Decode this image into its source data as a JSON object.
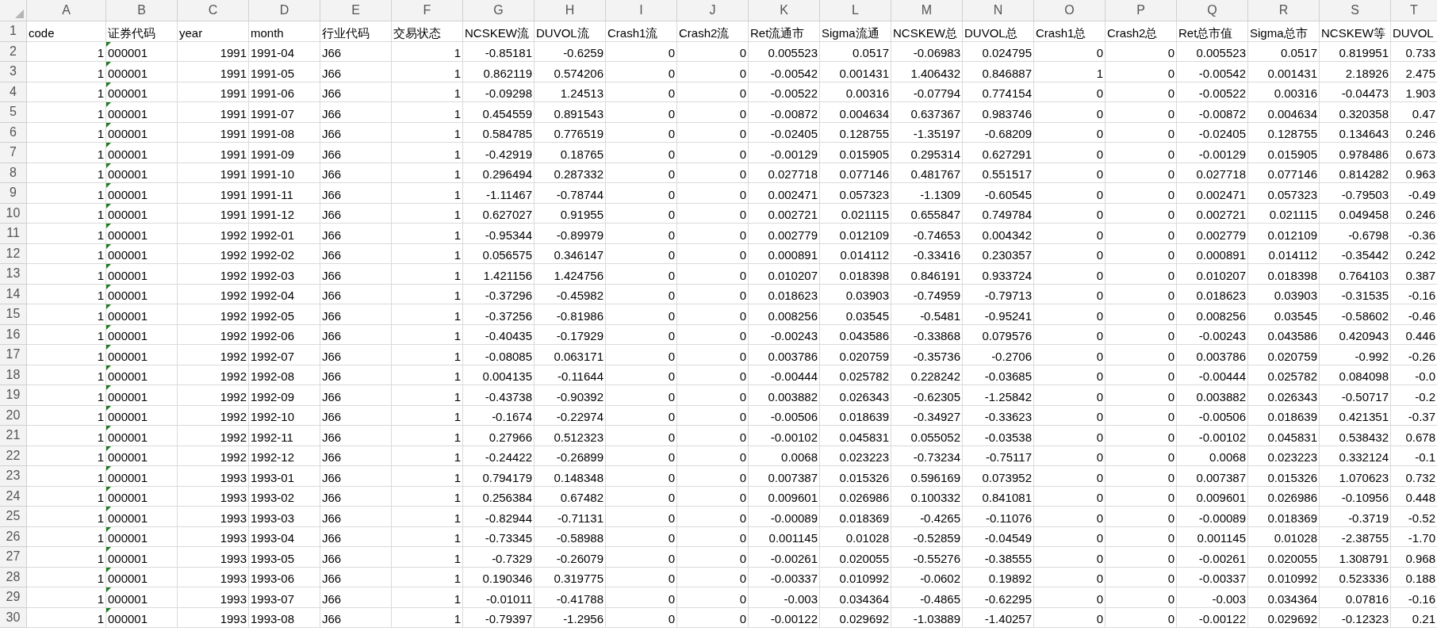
{
  "columns": [
    {
      "letter": "A",
      "header": "code",
      "kind": "number"
    },
    {
      "letter": "B",
      "header": "证券代码",
      "kind": "text_number"
    },
    {
      "letter": "C",
      "header": "year",
      "kind": "number"
    },
    {
      "letter": "D",
      "header": "month",
      "kind": "text"
    },
    {
      "letter": "E",
      "header": "行业代码",
      "kind": "text"
    },
    {
      "letter": "F",
      "header": "交易状态",
      "kind": "number"
    },
    {
      "letter": "G",
      "header": "NCSKEW流",
      "kind": "number"
    },
    {
      "letter": "H",
      "header": "DUVOL流",
      "kind": "number"
    },
    {
      "letter": "I",
      "header": "Crash1流",
      "kind": "number"
    },
    {
      "letter": "J",
      "header": "Crash2流",
      "kind": "number"
    },
    {
      "letter": "K",
      "header": "Ret流通市",
      "kind": "number"
    },
    {
      "letter": "L",
      "header": "Sigma流通",
      "kind": "number"
    },
    {
      "letter": "M",
      "header": "NCSKEW总",
      "kind": "number"
    },
    {
      "letter": "N",
      "header": "DUVOL总",
      "kind": "number"
    },
    {
      "letter": "O",
      "header": "Crash1总",
      "kind": "number"
    },
    {
      "letter": "P",
      "header": "Crash2总",
      "kind": "number"
    },
    {
      "letter": "Q",
      "header": "Ret总市值",
      "kind": "number"
    },
    {
      "letter": "R",
      "header": "Sigma总市",
      "kind": "number"
    },
    {
      "letter": "S",
      "header": "NCSKEW等",
      "kind": "number"
    },
    {
      "letter": "T",
      "header": "DUVOL",
      "kind": "number"
    }
  ],
  "header_row_number": "1",
  "rows": [
    {
      "number": "2",
      "cells": [
        "1",
        "000001",
        "1991",
        "1991-04",
        "J66",
        "1",
        "-0.85181",
        "-0.6259",
        "0",
        "0",
        "0.005523",
        "0.0517",
        "-0.06983",
        "0.024795",
        "0",
        "0",
        "0.005523",
        "0.0517",
        "0.819951",
        "0.733"
      ]
    },
    {
      "number": "3",
      "cells": [
        "1",
        "000001",
        "1991",
        "1991-05",
        "J66",
        "1",
        "0.862119",
        "0.574206",
        "0",
        "0",
        "-0.00542",
        "0.001431",
        "1.406432",
        "0.846887",
        "1",
        "0",
        "-0.00542",
        "0.001431",
        "2.18926",
        "2.475"
      ]
    },
    {
      "number": "4",
      "cells": [
        "1",
        "000001",
        "1991",
        "1991-06",
        "J66",
        "1",
        "-0.09298",
        "1.24513",
        "0",
        "0",
        "-0.00522",
        "0.00316",
        "-0.07794",
        "0.774154",
        "0",
        "0",
        "-0.00522",
        "0.00316",
        "-0.04473",
        "1.903"
      ]
    },
    {
      "number": "5",
      "cells": [
        "1",
        "000001",
        "1991",
        "1991-07",
        "J66",
        "1",
        "0.454559",
        "0.891543",
        "0",
        "0",
        "-0.00872",
        "0.004634",
        "0.637367",
        "0.983746",
        "0",
        "0",
        "-0.00872",
        "0.004634",
        "0.320358",
        "0.47"
      ]
    },
    {
      "number": "6",
      "cells": [
        "1",
        "000001",
        "1991",
        "1991-08",
        "J66",
        "1",
        "0.584785",
        "0.776519",
        "0",
        "0",
        "-0.02405",
        "0.128755",
        "-1.35197",
        "-0.68209",
        "0",
        "0",
        "-0.02405",
        "0.128755",
        "0.134643",
        "0.246"
      ]
    },
    {
      "number": "7",
      "cells": [
        "1",
        "000001",
        "1991",
        "1991-09",
        "J66",
        "1",
        "-0.42919",
        "0.18765",
        "0",
        "0",
        "-0.00129",
        "0.015905",
        "0.295314",
        "0.627291",
        "0",
        "0",
        "-0.00129",
        "0.015905",
        "0.978486",
        "0.673"
      ]
    },
    {
      "number": "8",
      "cells": [
        "1",
        "000001",
        "1991",
        "1991-10",
        "J66",
        "1",
        "0.296494",
        "0.287332",
        "0",
        "0",
        "0.027718",
        "0.077146",
        "0.481767",
        "0.551517",
        "0",
        "0",
        "0.027718",
        "0.077146",
        "0.814282",
        "0.963"
      ]
    },
    {
      "number": "9",
      "cells": [
        "1",
        "000001",
        "1991",
        "1991-11",
        "J66",
        "1",
        "-1.11467",
        "-0.78744",
        "0",
        "0",
        "0.002471",
        "0.057323",
        "-1.1309",
        "-0.60545",
        "0",
        "0",
        "0.002471",
        "0.057323",
        "-0.79503",
        "-0.49"
      ]
    },
    {
      "number": "10",
      "cells": [
        "1",
        "000001",
        "1991",
        "1991-12",
        "J66",
        "1",
        "0.627027",
        "0.91955",
        "0",
        "0",
        "0.002721",
        "0.021115",
        "0.655847",
        "0.749784",
        "0",
        "0",
        "0.002721",
        "0.021115",
        "0.049458",
        "0.246"
      ]
    },
    {
      "number": "11",
      "cells": [
        "1",
        "000001",
        "1992",
        "1992-01",
        "J66",
        "1",
        "-0.95344",
        "-0.89979",
        "0",
        "0",
        "0.002779",
        "0.012109",
        "-0.74653",
        "0.004342",
        "0",
        "0",
        "0.002779",
        "0.012109",
        "-0.6798",
        "-0.36"
      ]
    },
    {
      "number": "12",
      "cells": [
        "1",
        "000001",
        "1992",
        "1992-02",
        "J66",
        "1",
        "0.056575",
        "0.346147",
        "0",
        "0",
        "0.000891",
        "0.014112",
        "-0.33416",
        "0.230357",
        "0",
        "0",
        "0.000891",
        "0.014112",
        "-0.35442",
        "0.242"
      ]
    },
    {
      "number": "13",
      "cells": [
        "1",
        "000001",
        "1992",
        "1992-03",
        "J66",
        "1",
        "1.421156",
        "1.424756",
        "0",
        "0",
        "0.010207",
        "0.018398",
        "0.846191",
        "0.933724",
        "0",
        "0",
        "0.010207",
        "0.018398",
        "0.764103",
        "0.387"
      ]
    },
    {
      "number": "14",
      "cells": [
        "1",
        "000001",
        "1992",
        "1992-04",
        "J66",
        "1",
        "-0.37296",
        "-0.45982",
        "0",
        "0",
        "0.018623",
        "0.03903",
        "-0.74959",
        "-0.79713",
        "0",
        "0",
        "0.018623",
        "0.03903",
        "-0.31535",
        "-0.16"
      ]
    },
    {
      "number": "15",
      "cells": [
        "1",
        "000001",
        "1992",
        "1992-05",
        "J66",
        "1",
        "-0.37256",
        "-0.81986",
        "0",
        "0",
        "0.008256",
        "0.03545",
        "-0.5481",
        "-0.95241",
        "0",
        "0",
        "0.008256",
        "0.03545",
        "-0.58602",
        "-0.46"
      ]
    },
    {
      "number": "16",
      "cells": [
        "1",
        "000001",
        "1992",
        "1992-06",
        "J66",
        "1",
        "-0.40435",
        "-0.17929",
        "0",
        "0",
        "-0.00243",
        "0.043586",
        "-0.33868",
        "0.079576",
        "0",
        "0",
        "-0.00243",
        "0.043586",
        "0.420943",
        "0.446"
      ]
    },
    {
      "number": "17",
      "cells": [
        "1",
        "000001",
        "1992",
        "1992-07",
        "J66",
        "1",
        "-0.08085",
        "0.063171",
        "0",
        "0",
        "0.003786",
        "0.020759",
        "-0.35736",
        "-0.2706",
        "0",
        "0",
        "0.003786",
        "0.020759",
        "-0.992",
        "-0.26"
      ]
    },
    {
      "number": "18",
      "cells": [
        "1",
        "000001",
        "1992",
        "1992-08",
        "J66",
        "1",
        "0.004135",
        "-0.11644",
        "0",
        "0",
        "-0.00444",
        "0.025782",
        "0.228242",
        "-0.03685",
        "0",
        "0",
        "-0.00444",
        "0.025782",
        "0.084098",
        "-0.0"
      ]
    },
    {
      "number": "19",
      "cells": [
        "1",
        "000001",
        "1992",
        "1992-09",
        "J66",
        "1",
        "-0.43738",
        "-0.90392",
        "0",
        "0",
        "0.003882",
        "0.026343",
        "-0.62305",
        "-1.25842",
        "0",
        "0",
        "0.003882",
        "0.026343",
        "-0.50717",
        "-0.2"
      ]
    },
    {
      "number": "20",
      "cells": [
        "1",
        "000001",
        "1992",
        "1992-10",
        "J66",
        "1",
        "-0.1674",
        "-0.22974",
        "0",
        "0",
        "-0.00506",
        "0.018639",
        "-0.34927",
        "-0.33623",
        "0",
        "0",
        "-0.00506",
        "0.018639",
        "0.421351",
        "-0.37"
      ]
    },
    {
      "number": "21",
      "cells": [
        "1",
        "000001",
        "1992",
        "1992-11",
        "J66",
        "1",
        "0.27966",
        "0.512323",
        "0",
        "0",
        "-0.00102",
        "0.045831",
        "0.055052",
        "-0.03538",
        "0",
        "0",
        "-0.00102",
        "0.045831",
        "0.538432",
        "0.678"
      ]
    },
    {
      "number": "22",
      "cells": [
        "1",
        "000001",
        "1992",
        "1992-12",
        "J66",
        "1",
        "-0.24422",
        "-0.26899",
        "0",
        "0",
        "0.0068",
        "0.023223",
        "-0.73234",
        "-0.75117",
        "0",
        "0",
        "0.0068",
        "0.023223",
        "0.332124",
        "-0.1"
      ]
    },
    {
      "number": "23",
      "cells": [
        "1",
        "000001",
        "1993",
        "1993-01",
        "J66",
        "1",
        "0.794179",
        "0.148348",
        "0",
        "0",
        "0.007387",
        "0.015326",
        "0.596169",
        "0.073952",
        "0",
        "0",
        "0.007387",
        "0.015326",
        "1.070623",
        "0.732"
      ]
    },
    {
      "number": "24",
      "cells": [
        "1",
        "000001",
        "1993",
        "1993-02",
        "J66",
        "1",
        "0.256384",
        "0.67482",
        "0",
        "0",
        "0.009601",
        "0.026986",
        "0.100332",
        "0.841081",
        "0",
        "0",
        "0.009601",
        "0.026986",
        "-0.10956",
        "0.448"
      ]
    },
    {
      "number": "25",
      "cells": [
        "1",
        "000001",
        "1993",
        "1993-03",
        "J66",
        "1",
        "-0.82944",
        "-0.71131",
        "0",
        "0",
        "-0.00089",
        "0.018369",
        "-0.4265",
        "-0.11076",
        "0",
        "0",
        "-0.00089",
        "0.018369",
        "-0.3719",
        "-0.52"
      ]
    },
    {
      "number": "26",
      "cells": [
        "1",
        "000001",
        "1993",
        "1993-04",
        "J66",
        "1",
        "-0.73345",
        "-0.58988",
        "0",
        "0",
        "0.001145",
        "0.01028",
        "-0.52859",
        "-0.04549",
        "0",
        "0",
        "0.001145",
        "0.01028",
        "-2.38755",
        "-1.70"
      ]
    },
    {
      "number": "27",
      "cells": [
        "1",
        "000001",
        "1993",
        "1993-05",
        "J66",
        "1",
        "-0.7329",
        "-0.26079",
        "0",
        "0",
        "-0.00261",
        "0.020055",
        "-0.55276",
        "-0.38555",
        "0",
        "0",
        "-0.00261",
        "0.020055",
        "1.308791",
        "0.968"
      ]
    },
    {
      "number": "28",
      "cells": [
        "1",
        "000001",
        "1993",
        "1993-06",
        "J66",
        "1",
        "0.190346",
        "0.319775",
        "0",
        "0",
        "-0.00337",
        "0.010992",
        "-0.0602",
        "0.19892",
        "0",
        "0",
        "-0.00337",
        "0.010992",
        "0.523336",
        "0.188"
      ]
    },
    {
      "number": "29",
      "cells": [
        "1",
        "000001",
        "1993",
        "1993-07",
        "J66",
        "1",
        "-0.01011",
        "-0.41788",
        "0",
        "0",
        "-0.003",
        "0.034364",
        "-0.4865",
        "-0.62295",
        "0",
        "0",
        "-0.003",
        "0.034364",
        "0.07816",
        "-0.16"
      ]
    },
    {
      "number": "30",
      "cells": [
        "1",
        "000001",
        "1993",
        "1993-08",
        "J66",
        "1",
        "-0.79397",
        "-1.2956",
        "0",
        "0",
        "-0.00122",
        "0.029692",
        "-1.03889",
        "-1.40257",
        "0",
        "0",
        "-0.00122",
        "0.029692",
        "-0.12323",
        "0.21"
      ]
    }
  ]
}
